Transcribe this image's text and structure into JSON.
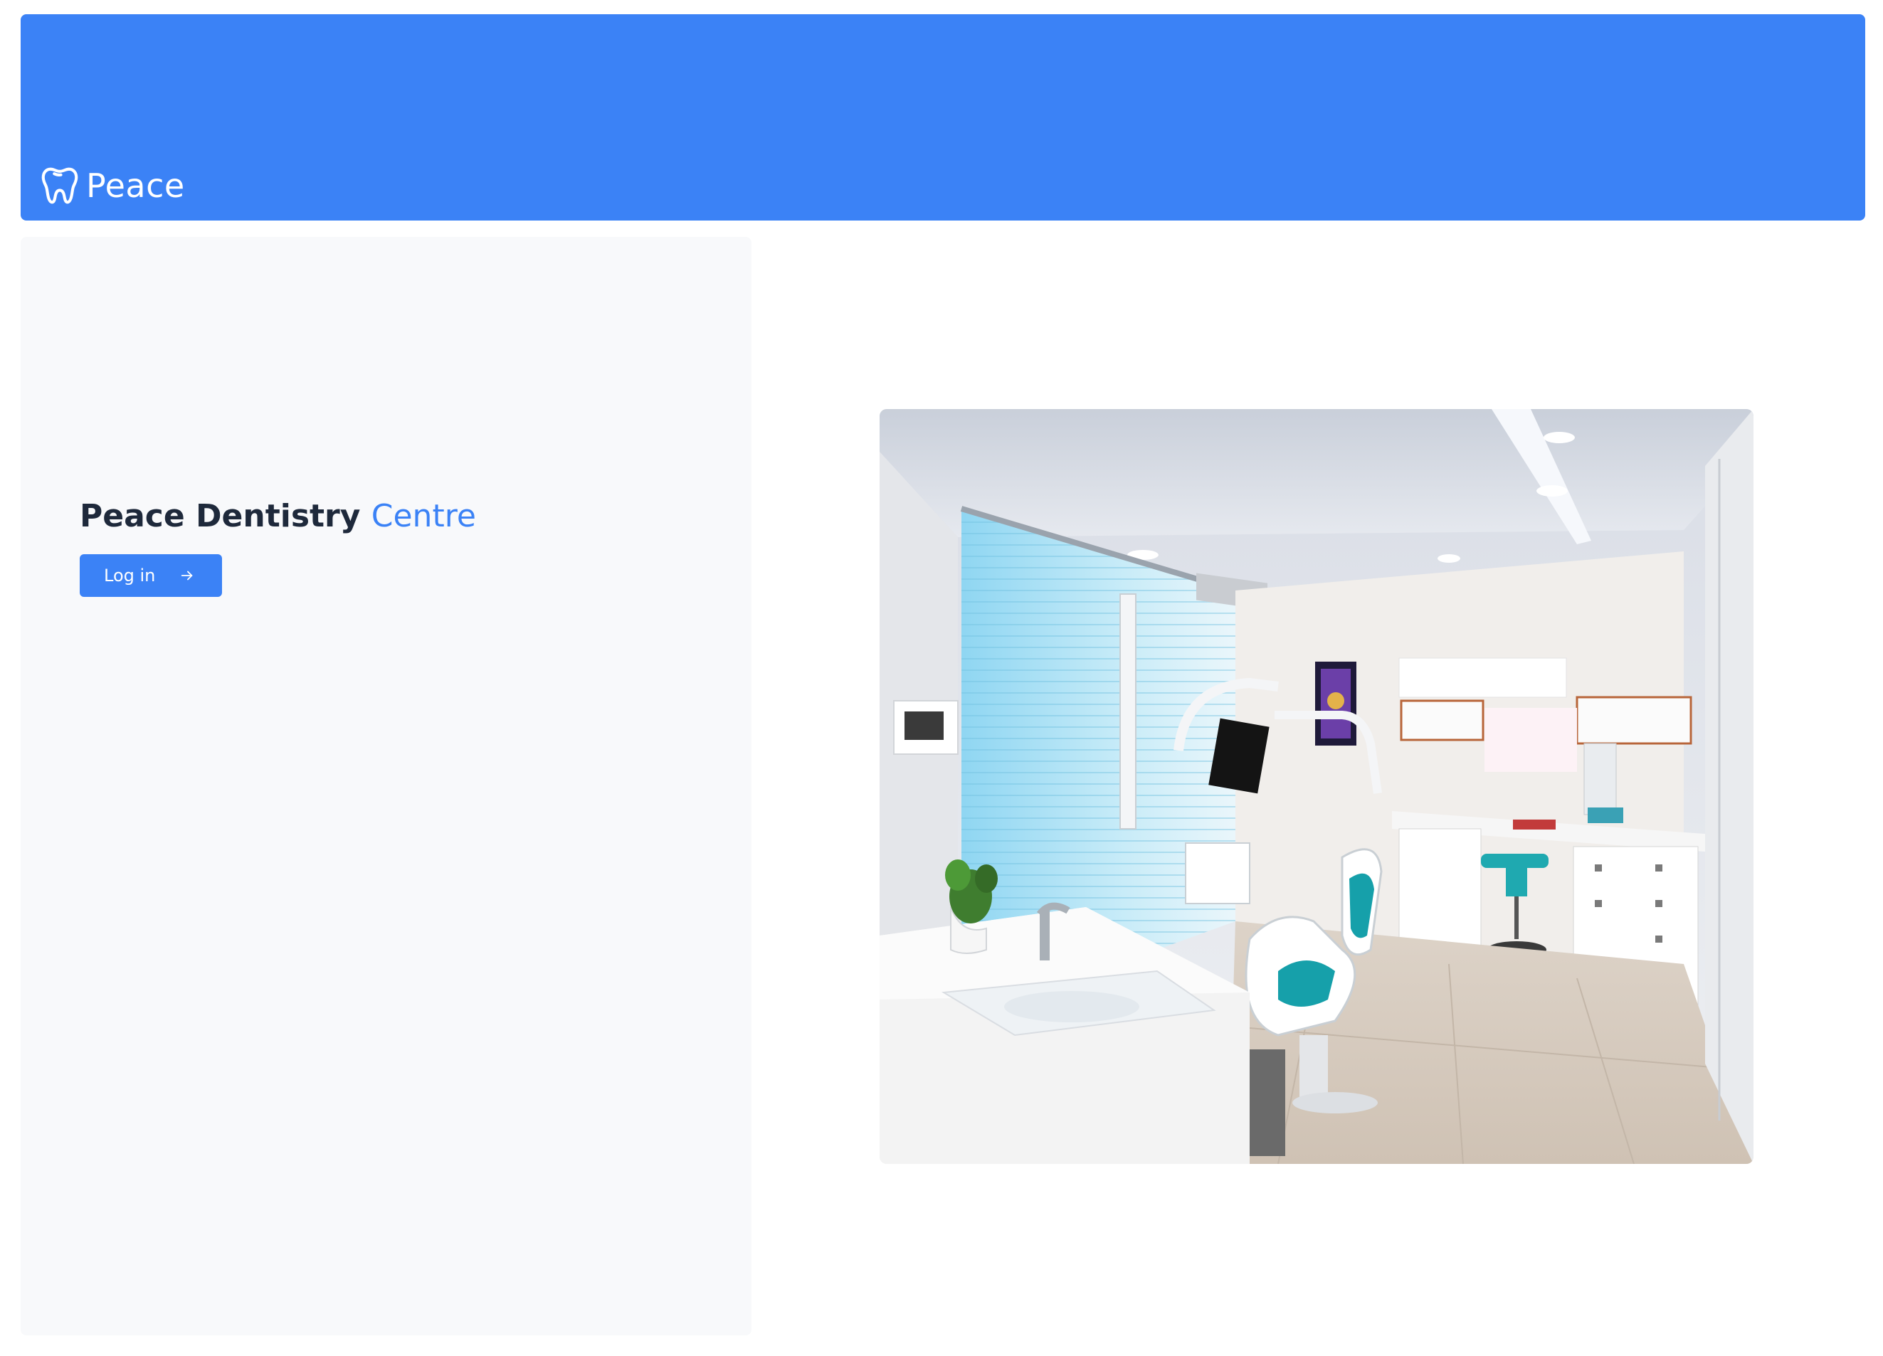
{
  "header": {
    "brand_name": "Peace",
    "brand_icon": "tooth-icon",
    "background_color": "#3b82f6"
  },
  "hero": {
    "title_main": "Peace Dentistry",
    "title_accent": "Centre",
    "login_label": "Log in",
    "login_icon": "arrow-right-icon",
    "accent_color": "#3b82f6",
    "text_color": "#1e293b"
  },
  "photo": {
    "subject": "dental-clinic-room-image"
  }
}
